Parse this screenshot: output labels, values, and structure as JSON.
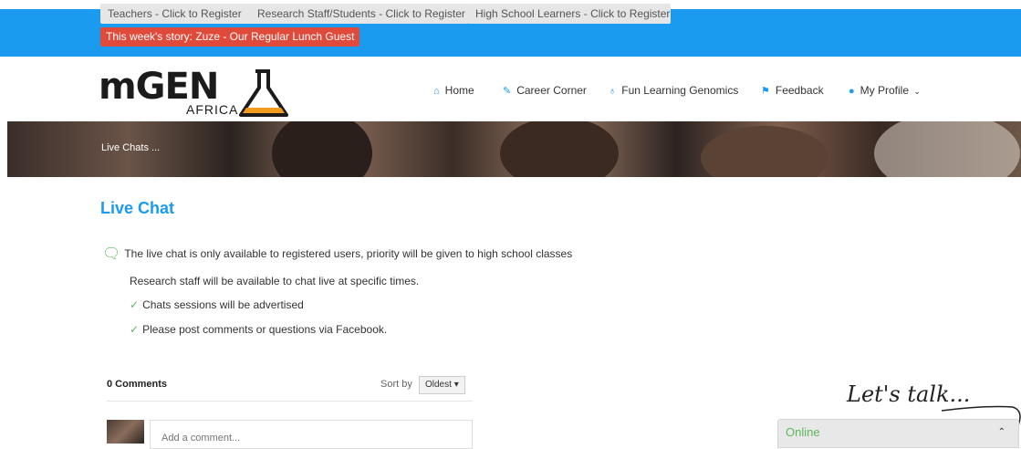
{
  "topbar": {
    "registration_buttons": [
      "Teachers - Click to Register",
      "Research Staff/Students - Click to Register",
      "High School Learners - Click to Register"
    ],
    "story_label": "This week's story: Zuze - Our Regular Lunch Guest",
    "color": "#1a9bf0"
  },
  "header": {
    "logo_main": "mGEN",
    "logo_sub": "AFRICA",
    "nav": [
      {
        "label": "Home",
        "icon": "home-icon"
      },
      {
        "label": "Career Corner",
        "icon": "flask-icon"
      },
      {
        "label": "Fun Learning Genomics",
        "icon": "dna-icon"
      },
      {
        "label": "Feedback",
        "icon": "flag-icon"
      },
      {
        "label": "My Profile",
        "icon": "user-icon"
      }
    ]
  },
  "banner": {
    "text": "Live Chats ..."
  },
  "main": {
    "title": "Live Chat",
    "intro": "The live chat is only available to registered users, priority will be given to high school classes",
    "paragraph": "Research staff will be available to chat live at specific times.",
    "bullets": [
      "Chats sessions will be advertised",
      "Please post comments or questions via Facebook."
    ]
  },
  "comments": {
    "count_label": "0 Comments",
    "sort_label": "Sort by",
    "sort_value": "Oldest",
    "placeholder": "Add a comment..."
  },
  "chat_widget": {
    "tagline": "Let's talk...",
    "status": "Online",
    "status_color": "#5cb85c"
  }
}
